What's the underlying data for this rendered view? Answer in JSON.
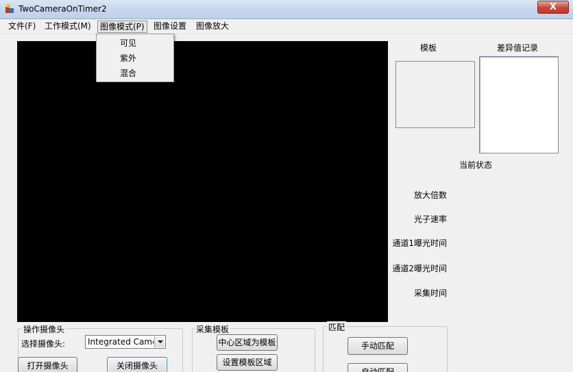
{
  "window": {
    "title": "TwoCameraOnTimer2",
    "close_glyph": "X"
  },
  "menu": {
    "items": [
      "文件(F)",
      "工作模式(M)",
      "图像模式(P)",
      "图像设置",
      "图像放大"
    ],
    "open_index": 2,
    "dropdown_items": [
      "可见",
      "紫外",
      "混合"
    ]
  },
  "side": {
    "template_label": "模板",
    "diff_log_label": "差异值记录",
    "current_state_label": "当前状态",
    "fields": [
      "放大倍数",
      "光子速率",
      "通道1曝光时间",
      "通道2曝光时间",
      "采集时间"
    ]
  },
  "camera_group": {
    "title": "操作摄像头",
    "select_label": "选择摄像头:",
    "select_value": "Integrated Camer",
    "open_button": "打开摄像头",
    "close_button": "关闭摄像头"
  },
  "capture_group": {
    "title": "采集模板",
    "center_button": "中心区域为模板",
    "set_region_button": "设置模板区域"
  },
  "match_group": {
    "title": "匹配",
    "manual_button": "手动匹配",
    "auto_button": "自动匹配"
  }
}
